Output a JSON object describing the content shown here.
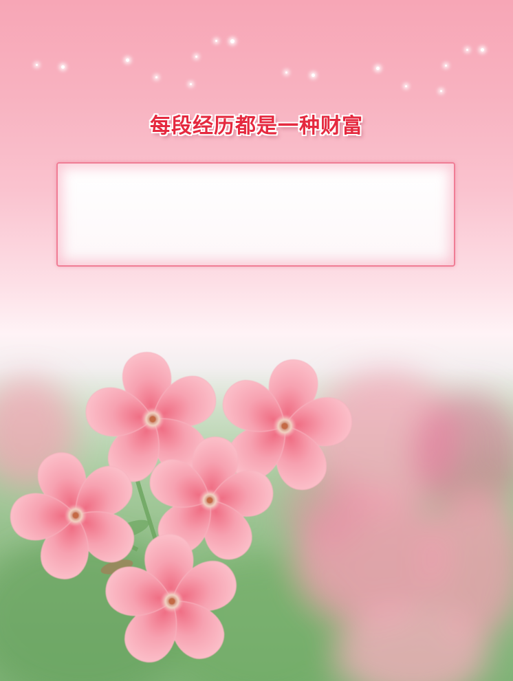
{
  "title": "每段经历都是一种财富",
  "content_box": {
    "text": ""
  },
  "colors": {
    "title": "#e5293f",
    "box_border": "#f07d95",
    "petal": "#f48a9c",
    "petal_light": "#fbc2cb",
    "leaf": "#6ea661"
  },
  "decor": {
    "sparkles": "white-sparkles",
    "flowers": "pink-phlox-flowers"
  }
}
